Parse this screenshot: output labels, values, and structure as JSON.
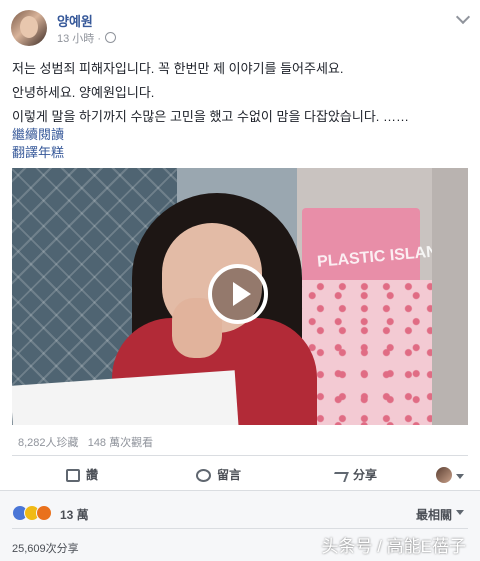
{
  "post": {
    "author": "양예원",
    "time": "13 小時 ·",
    "lines": [
      "저는 성범죄 피해자입니다. 꼭 한번만 제 이야기를 들어주세요.",
      "안녕하세요. 양예원입니다.",
      "이렇게 말을 하기까지 수많은 고민을 했고 수없이 맘을 다잡았습니다. ……"
    ],
    "read_more": "繼續閱讀",
    "translate": "翻譯年糕"
  },
  "video": {
    "bag_text": "PLASTIC ISLAND"
  },
  "stats": "8,282人珍藏   148 萬次觀看",
  "actions": {
    "like": "讚",
    "comment": "留言",
    "share": "分享"
  },
  "reactions": {
    "count": "13 萬",
    "sort": "最相關",
    "shares": "25,609次分享"
  },
  "watermark": "头条号 / 高能E蓓子",
  "icons": [
    "globe-icon",
    "chevron-down-icon",
    "play-icon",
    "like-icon",
    "comment-icon",
    "share-icon",
    "like-reaction-icon",
    "wow-reaction-icon",
    "sad-reaction-icon"
  ]
}
